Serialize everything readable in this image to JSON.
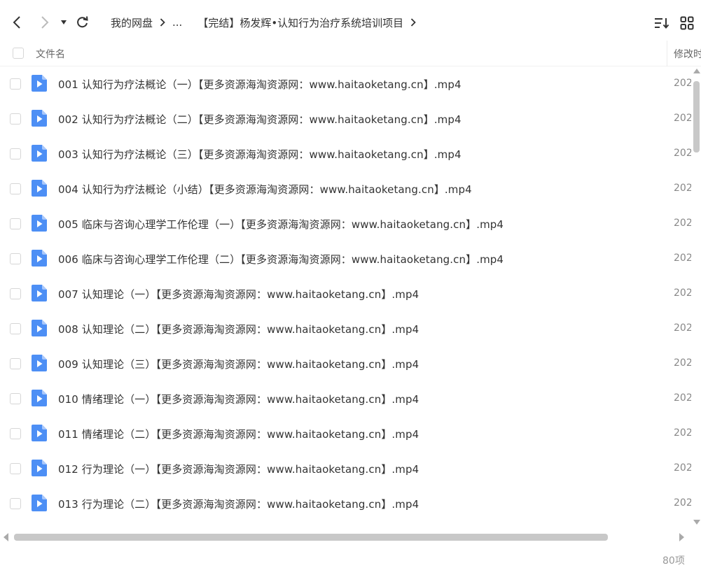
{
  "toolbar": {
    "icons": {
      "back": "chevron-left-icon",
      "forward": "chevron-right-icon",
      "history": "caret-down-icon",
      "refresh": "refresh-icon",
      "sort": "sort-icon",
      "grid": "grid-view-icon"
    },
    "breadcrumb": {
      "root": "我的网盘",
      "ellipsis": "...",
      "current": "【完结】杨发辉•认知行为治疗系统培训项目"
    }
  },
  "header": {
    "name_label": "文件名",
    "modified_label": "修改时间"
  },
  "colors": {
    "file_icon_blue": "#4d8ff5",
    "text": "#333333",
    "scrollbar": "#c8c8c8"
  },
  "files": [
    {
      "name": "001 认知行为疗法概论（一）【更多资源海淘资源网：www.haitaoketang.cn】.mp4",
      "date": "202"
    },
    {
      "name": "002 认知行为疗法概论（二）【更多资源海淘资源网：www.haitaoketang.cn】.mp4",
      "date": "202"
    },
    {
      "name": "003 认知行为疗法概论（三）【更多资源海淘资源网：www.haitaoketang.cn】.mp4",
      "date": "202"
    },
    {
      "name": "004 认知行为疗法概论（小结）【更多资源海淘资源网：www.haitaoketang.cn】.mp4",
      "date": "202"
    },
    {
      "name": "005 临床与咨询心理学工作伦理（一）【更多资源海淘资源网：www.haitaoketang.cn】.mp4",
      "date": "202"
    },
    {
      "name": "006 临床与咨询心理学工作伦理（二）【更多资源海淘资源网：www.haitaoketang.cn】.mp4",
      "date": "202"
    },
    {
      "name": "007 认知理论（一）【更多资源海淘资源网：www.haitaoketang.cn】.mp4",
      "date": "202"
    },
    {
      "name": "008 认知理论（二）【更多资源海淘资源网：www.haitaoketang.cn】.mp4",
      "date": "202"
    },
    {
      "name": "009 认知理论（三）【更多资源海淘资源网：www.haitaoketang.cn】.mp4",
      "date": "202"
    },
    {
      "name": "010 情绪理论（一）【更多资源海淘资源网：www.haitaoketang.cn】.mp4",
      "date": "202"
    },
    {
      "name": "011 情绪理论（二）【更多资源海淘资源网：www.haitaoketang.cn】.mp4",
      "date": "202"
    },
    {
      "name": "012 行为理论（一）【更多资源海淘资源网：www.haitaoketang.cn】.mp4",
      "date": "202"
    },
    {
      "name": "013 行为理论（二）【更多资源海淘资源网：www.haitaoketang.cn】.mp4",
      "date": "202"
    }
  ],
  "footer": {
    "count": "80项"
  }
}
